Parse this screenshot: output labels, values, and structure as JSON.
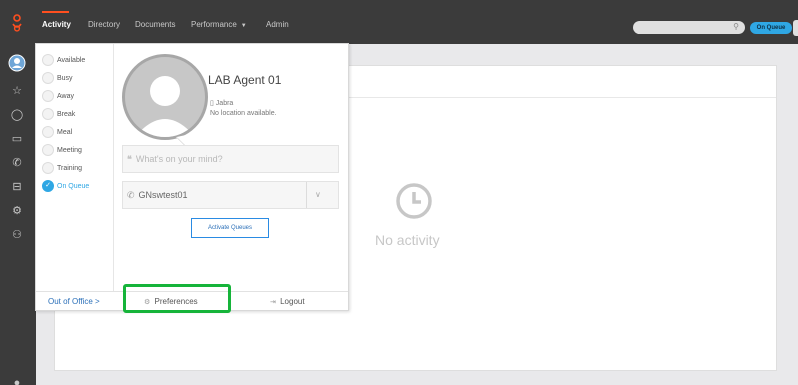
{
  "topbar": {
    "nav": [
      {
        "label": "Activity",
        "active": true
      },
      {
        "label": "Directory",
        "active": false
      },
      {
        "label": "Documents",
        "active": false
      },
      {
        "label": "Performance",
        "active": false,
        "dropdown": true
      },
      {
        "label": "Admin",
        "active": false
      }
    ],
    "search_placeholder": "",
    "status_pill": "On Queue"
  },
  "rail": {
    "icons": [
      "avatar-icon",
      "star-icon",
      "chat-icon",
      "video-icon",
      "phone-icon",
      "inbox-icon",
      "settings-icon",
      "people-icon",
      "help-icon"
    ]
  },
  "statuses": [
    {
      "label": "Available",
      "selected": false
    },
    {
      "label": "Busy",
      "selected": false
    },
    {
      "label": "Away",
      "selected": false
    },
    {
      "label": "Break",
      "selected": false
    },
    {
      "label": "Meal",
      "selected": false
    },
    {
      "label": "Meeting",
      "selected": false
    },
    {
      "label": "Training",
      "selected": false
    },
    {
      "label": "On Queue",
      "selected": true
    }
  ],
  "profile": {
    "name": "LAB Agent 01",
    "device": "Jabra",
    "location": "No location available.",
    "mind_placeholder": "What's on your mind?",
    "phone": "GNswtest01",
    "activate_label": "Activate Queues"
  },
  "footer": {
    "out_of_office": "Out of Office",
    "preferences": "Preferences",
    "logout": "Logout"
  },
  "content": {
    "empty_text": "No activity"
  },
  "colors": {
    "accent": "#2fa7e4",
    "brand": "#ff4f1f",
    "highlight": "#16b43a"
  }
}
